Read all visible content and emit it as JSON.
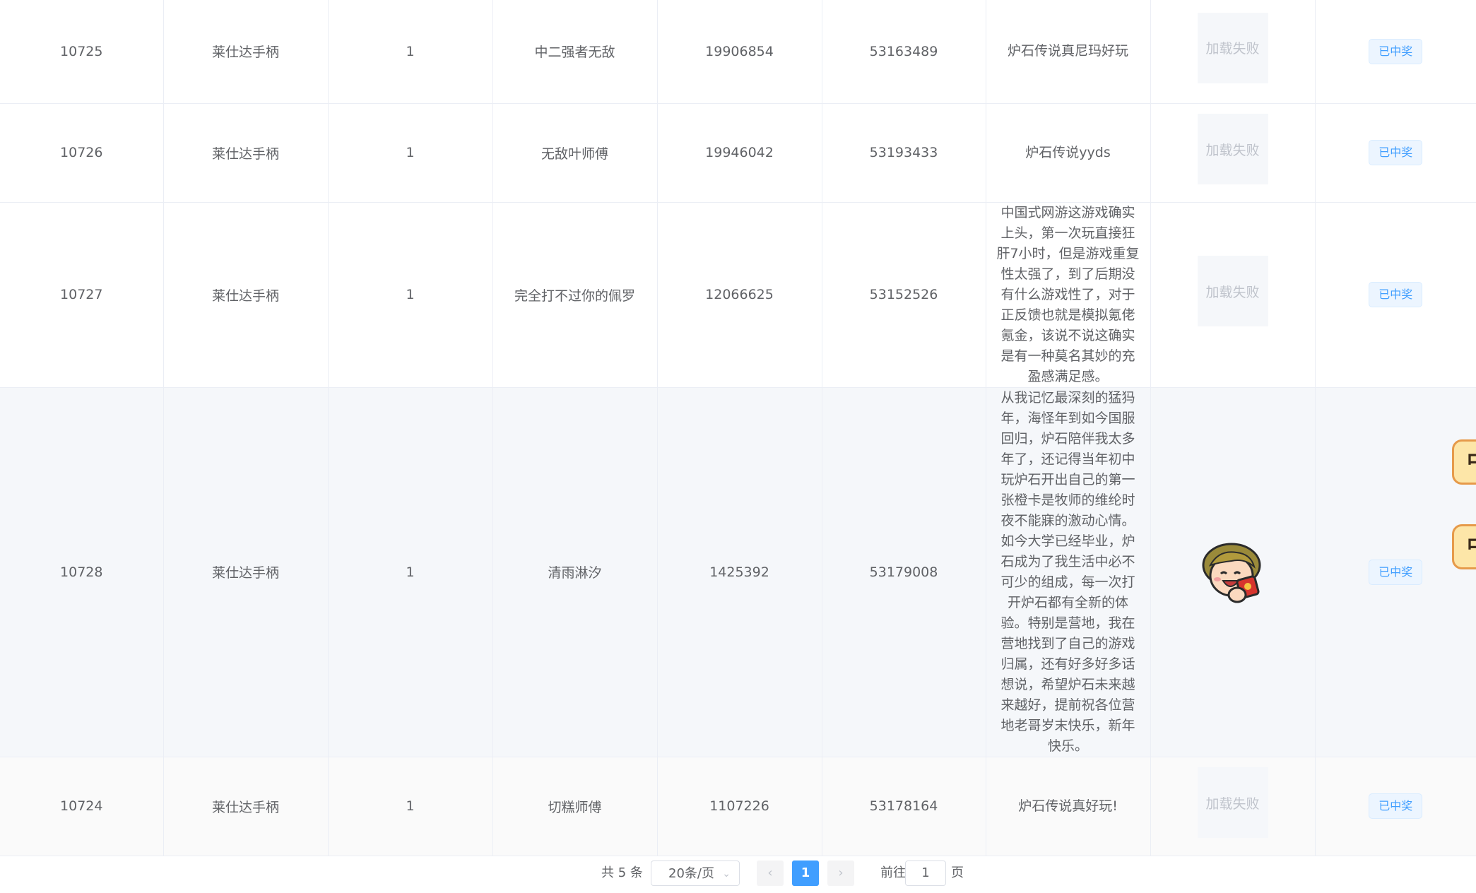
{
  "rows": [
    {
      "id": "10725",
      "product": "莱仕达手柄",
      "qty": "1",
      "nickname": "中二强者无敌",
      "uid": "19906854",
      "order": "53163489",
      "comment": "炉石传说真尼玛好玩",
      "image_text": "加载失败",
      "status": "已中奖"
    },
    {
      "id": "10726",
      "product": "莱仕达手柄",
      "qty": "1",
      "nickname": "无敌叶师傅",
      "uid": "19946042",
      "order": "53193433",
      "comment": "炉石传说yyds",
      "image_text": "加载失败",
      "status": "已中奖"
    },
    {
      "id": "10727",
      "product": "莱仕达手柄",
      "qty": "1",
      "nickname": "完全打不过你的佩罗",
      "uid": "12066625",
      "order": "53152526",
      "comment": "中国式网游这游戏确实上头，第一次玩直接狂肝7小时，但是游戏重复性太强了，到了后期没有什么游戏性了，对于正反馈也就是模拟氪佬氪金，该说不说这确实是有一种莫名其妙的充盈感满足感。",
      "image_text": "加载失败",
      "status": "已中奖"
    },
    {
      "id": "10728",
      "product": "莱仕达手柄",
      "qty": "1",
      "nickname": "清雨淋汐",
      "uid": "1425392",
      "order": "53179008",
      "comment": "从我记忆最深刻的猛犸年，海怪年到如今国服回归，炉石陪伴我太多年了，还记得当年初中玩炉石开出自己的第一张橙卡是牧师的维纶时夜不能寐的激动心情。如今大学已经毕业，炉石成为了我生活中必不可少的组成，每一次打开炉石都有全新的体验。特别是营地，我在营地找到了自己的游戏归属，还有好多好多话想说，希望炉石未来越来越好，提前祝各位营地老哥岁末快乐，新年快乐。",
      "image_text": "",
      "status": "已中奖"
    },
    {
      "id": "10724",
      "product": "莱仕达手柄",
      "qty": "1",
      "nickname": "切糕师傅",
      "uid": "1107226",
      "order": "53178164",
      "comment": "炉石传说真好玩!",
      "image_text": "加载失败",
      "status": "已中奖"
    }
  ],
  "float_buttons": [
    "中",
    "中"
  ],
  "pagination": {
    "total": "共 5 条",
    "page_size": "20条/页",
    "current_page": "1",
    "goto_label": "前往",
    "goto_value": "1",
    "page_suffix": "页"
  },
  "icons": {
    "prev": "chevron-left-icon",
    "next": "chevron-right-icon",
    "select_arrow": "chevron-down-icon"
  },
  "colors": {
    "tag_text": "#409eff",
    "tag_bg": "#ecf5ff",
    "active_page": "#409eff"
  }
}
